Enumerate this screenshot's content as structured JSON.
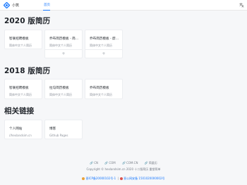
{
  "header": {
    "brand": "小筑",
    "nav": [
      {
        "label": "首页",
        "active": true
      }
    ],
    "lang_icon": "translate-icon",
    "accent": "#1677ff"
  },
  "sections": [
    {
      "title": "2020 版简历",
      "cards": [
        {
          "title": "智联招聘模板",
          "subtitle": "简体中文个人简历",
          "expandable": false
        },
        {
          "title": "乔布简历模板 - 简...",
          "subtitle": "简体中文个人简历",
          "expandable": true
        },
        {
          "title": "乔布简历模板 - 蔚...",
          "subtitle": "简体中文个人简历",
          "expandable": true
        }
      ]
    },
    {
      "title": "2018 版简历",
      "cards": [
        {
          "title": "智联招聘模板",
          "subtitle": "简体中文个人简历",
          "expandable": false
        },
        {
          "title": "拉勾简历模板",
          "subtitle": "简体中文个人简历",
          "expandable": false
        },
        {
          "title": "乔布简历模板",
          "subtitle": "简体中文个人简历",
          "expandable": false
        }
      ]
    },
    {
      "title": "相关链接",
      "cards": [
        {
          "title": "个人网站",
          "subtitle": "//hexlandsim.cn",
          "expandable": false
        },
        {
          "title": "博客",
          "subtitle": "Github Pages",
          "expandable": false
        }
      ]
    }
  ],
  "footer": {
    "links": [
      {
        "icon": "link-icon",
        "label": "CN"
      },
      {
        "icon": "link-icon",
        "label": "COM"
      },
      {
        "icon": "link-icon",
        "label": "COM.CN"
      },
      {
        "icon": "link-icon",
        "label": "简量历"
      }
    ],
    "copyright": "Copyright © hexlandsim.cn 2020 十二版简历 重塑简单",
    "beian": [
      {
        "text": "晋ICP备20000102号-1"
      },
      {
        "text": "晋公网安备 1501020000002号"
      }
    ]
  }
}
